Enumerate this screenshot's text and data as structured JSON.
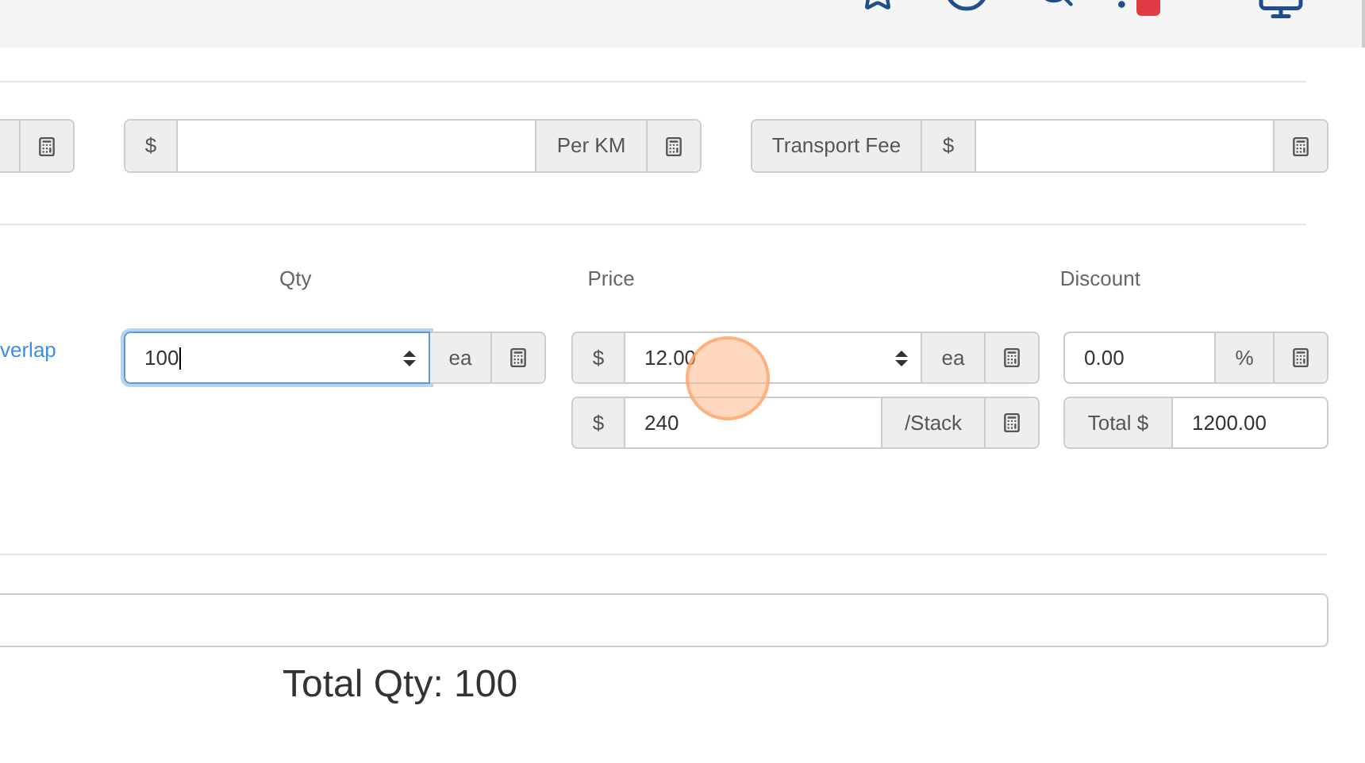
{
  "per_km": {
    "prefix": "$",
    "suffix": "Per KM"
  },
  "transport_fee": {
    "label": "Transport Fee",
    "prefix": "$"
  },
  "columns": [
    "Qty",
    "Price",
    "Discount"
  ],
  "item": {
    "link": "verlap",
    "qty": {
      "value": "100",
      "unit": "ea",
      "focused": true
    },
    "price": {
      "prefix": "$",
      "value": "12.00",
      "unit": "ea"
    },
    "stack_price": {
      "prefix": "$",
      "value": "240",
      "unit": "/Stack"
    },
    "discount": {
      "value": "0.00",
      "unit": "%"
    },
    "total": {
      "label": "Total $",
      "value": "1200.00"
    }
  },
  "total_qty": "Total Qty: 100"
}
